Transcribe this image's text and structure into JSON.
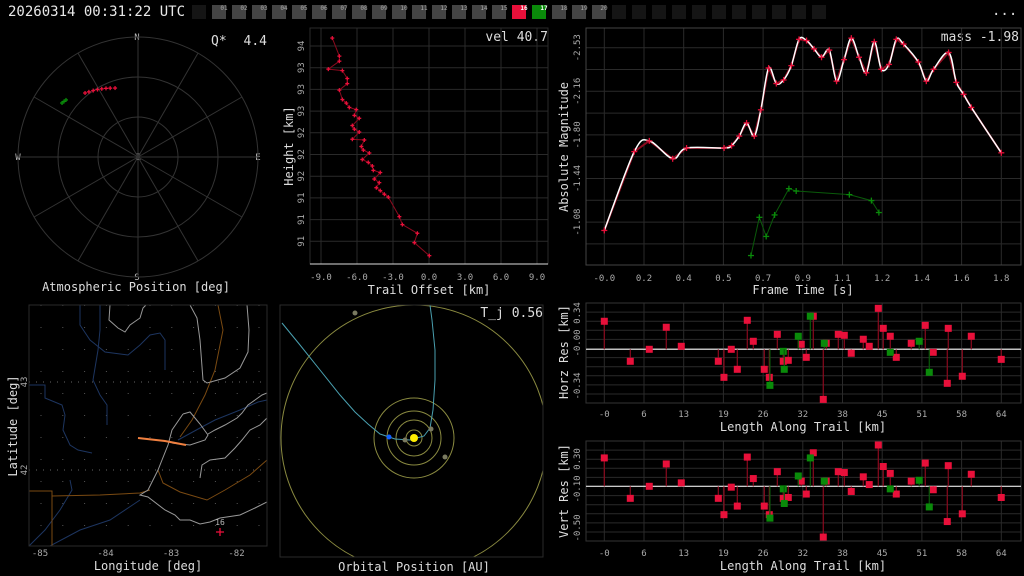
{
  "header": {
    "timestamp": "20260314 00:31:22 UTC",
    "more_label": "...",
    "stations": [
      {
        "label": "",
        "state": "empty"
      },
      {
        "label": "01",
        "state": "idle"
      },
      {
        "label": "02",
        "state": "idle"
      },
      {
        "label": "03",
        "state": "idle"
      },
      {
        "label": "04",
        "state": "idle"
      },
      {
        "label": "05",
        "state": "idle"
      },
      {
        "label": "06",
        "state": "idle"
      },
      {
        "label": "07",
        "state": "idle"
      },
      {
        "label": "08",
        "state": "idle"
      },
      {
        "label": "09",
        "state": "idle"
      },
      {
        "label": "10",
        "state": "idle"
      },
      {
        "label": "11",
        "state": "idle"
      },
      {
        "label": "12",
        "state": "idle"
      },
      {
        "label": "13",
        "state": "idle"
      },
      {
        "label": "14",
        "state": "idle"
      },
      {
        "label": "15",
        "state": "idle"
      },
      {
        "label": "16",
        "state": "red"
      },
      {
        "label": "17",
        "state": "green"
      },
      {
        "label": "18",
        "state": "idle"
      },
      {
        "label": "19",
        "state": "idle"
      },
      {
        "label": "20",
        "state": "idle"
      },
      {
        "label": "",
        "state": "empty"
      },
      {
        "label": "",
        "state": "empty"
      },
      {
        "label": "",
        "state": "empty"
      },
      {
        "label": "",
        "state": "empty"
      },
      {
        "label": "",
        "state": "empty"
      },
      {
        "label": "",
        "state": "empty"
      },
      {
        "label": "",
        "state": "empty"
      },
      {
        "label": "",
        "state": "empty"
      },
      {
        "label": "",
        "state": "empty"
      },
      {
        "label": "",
        "state": "empty"
      },
      {
        "label": "",
        "state": "empty"
      }
    ]
  },
  "colors": {
    "red": "#e8103a",
    "green": "#0a8a0a",
    "stem_red": "#8b0a1e",
    "stem_green": "#0a5a0a",
    "grid": "#2a2a2a",
    "idle": "#444444",
    "empty": "#151515"
  },
  "chart_data": [
    {
      "type": "scatter",
      "id": "atmospheric",
      "title": "Atmospheric Position [deg]",
      "annotation_label": "Q*",
      "annotation_value": "4.4",
      "directions": {
        "n": "N",
        "e": "E",
        "s": "S",
        "w": "W",
        "z": "Z"
      },
      "series": [
        {
          "name": "16",
          "color": "#e8103a",
          "points_az_el": [
            [
              320.4,
              27.7
            ],
            [
              323,
              28.8
            ],
            [
              326,
              29.9
            ],
            [
              329,
              31
            ],
            [
              332,
              32.1
            ],
            [
              335,
              33.2
            ],
            [
              338,
              34.3
            ],
            [
              341.6,
              35.5
            ]
          ]
        },
        {
          "name": "17",
          "color": "#0a8a0a",
          "points_az_el": [
            [
              305.4,
              20.1
            ],
            [
              306.9,
              20.6
            ],
            [
              308.4,
              21.1
            ]
          ]
        }
      ]
    },
    {
      "type": "line",
      "id": "height",
      "annotation_label": "vel",
      "annotation_value": "40.7",
      "xlabel": "Trail Offset [km]",
      "ylabel": "Height [km]",
      "xlim": [
        -9,
        9
      ],
      "xticks": [
        "-9.0",
        "-6.0",
        "-3.0",
        "0.0",
        "3.0",
        "6.0",
        "9.0"
      ],
      "yticks": [
        "94",
        "93",
        "93",
        "93",
        "92",
        "92",
        "92",
        "91",
        "91",
        "91"
      ],
      "points": [
        [
          -8.06,
          94.11
        ],
        [
          -7.47,
          93.86
        ],
        [
          -7.47,
          93.79
        ],
        [
          -8.39,
          93.68
        ],
        [
          -7.22,
          93.66
        ],
        [
          -6.81,
          93.55
        ],
        [
          -6.81,
          93.48
        ],
        [
          -7.47,
          93.39
        ],
        [
          -7.22,
          93.26
        ],
        [
          -6.89,
          93.21
        ],
        [
          -6.64,
          93.15
        ],
        [
          -6.06,
          93.12
        ],
        [
          -6.22,
          93.04
        ],
        [
          -5.81,
          93.0
        ],
        [
          -6.39,
          92.9
        ],
        [
          -6.22,
          92.85
        ],
        [
          -5.81,
          92.81
        ],
        [
          -6.39,
          92.71
        ],
        [
          -5.39,
          92.7
        ],
        [
          -5.64,
          92.61
        ],
        [
          -5.47,
          92.56
        ],
        [
          -4.97,
          92.52
        ],
        [
          -5.56,
          92.43
        ],
        [
          -5.06,
          92.39
        ],
        [
          -4.72,
          92.34
        ],
        [
          -4.64,
          92.28
        ],
        [
          -4.06,
          92.25
        ],
        [
          -4.56,
          92.16
        ],
        [
          -4.14,
          92.11
        ],
        [
          -4.39,
          92.04
        ],
        [
          -4.06,
          92.0
        ],
        [
          -3.72,
          91.95
        ],
        [
          -3.39,
          91.91
        ],
        [
          -2.47,
          91.64
        ],
        [
          -2.22,
          91.53
        ],
        [
          -0.97,
          91.41
        ],
        [
          -1.22,
          91.28
        ],
        [
          0.03,
          91.1
        ]
      ]
    },
    {
      "type": "line",
      "id": "magnitude",
      "annotation_label": "mass",
      "annotation_value": "-1.98",
      "xlabel": "Frame Time [s]",
      "ylabel": "Absolute Magnitude",
      "xlim": [
        0,
        1.8
      ],
      "xticks": [
        "-0.0",
        "0.2",
        "0.4",
        "0.5",
        "0.7",
        "0.9",
        "1.1",
        "1.2",
        "1.4",
        "1.6",
        "1.8"
      ],
      "yticks": [
        "-2.53",
        "-2.16",
        "-1.80",
        "-1.44",
        "-1.08"
      ],
      "series": [
        {
          "name": "16",
          "color": "#e8103a",
          "points": [
            [
              0,
              -1.0
            ],
            [
              0.136,
              -1.66
            ],
            [
              0.204,
              -1.75
            ],
            [
              0.31,
              -1.6
            ],
            [
              0.373,
              -1.69
            ],
            [
              0.543,
              -1.69
            ],
            [
              0.577,
              -1.71
            ],
            [
              0.612,
              -1.79
            ],
            [
              0.645,
              -1.9
            ],
            [
              0.68,
              -1.79
            ],
            [
              0.71,
              -2.01
            ],
            [
              0.745,
              -2.36
            ],
            [
              0.78,
              -2.23
            ],
            [
              0.813,
              -2.26
            ],
            [
              0.848,
              -2.38
            ],
            [
              0.883,
              -2.6
            ],
            [
              0.917,
              -2.59
            ],
            [
              0.951,
              -2.52
            ],
            [
              0.985,
              -2.45
            ],
            [
              1.02,
              -2.51
            ],
            [
              1.053,
              -2.25
            ],
            [
              1.087,
              -2.43
            ],
            [
              1.12,
              -2.61
            ],
            [
              1.155,
              -2.45
            ],
            [
              1.188,
              -2.32
            ],
            [
              1.224,
              -2.58
            ],
            [
              1.256,
              -2.35
            ],
            [
              1.291,
              -2.39
            ],
            [
              1.324,
              -2.6
            ],
            [
              1.357,
              -2.56
            ],
            [
              1.424,
              -2.41
            ],
            [
              1.46,
              -2.25
            ],
            [
              1.493,
              -2.35
            ],
            [
              1.561,
              -2.49
            ],
            [
              1.596,
              -2.24
            ],
            [
              1.629,
              -2.14
            ],
            [
              1.664,
              -2.03
            ],
            [
              1.8,
              -1.65
            ]
          ]
        },
        {
          "name": "17",
          "color": "#0a8a0a",
          "points": [
            [
              0.665,
              -0.79
            ],
            [
              0.703,
              -1.11
            ],
            [
              0.734,
              -0.95
            ],
            [
              0.772,
              -1.13
            ],
            [
              0.837,
              -1.35
            ],
            [
              0.87,
              -1.33
            ],
            [
              1.111,
              -1.3
            ],
            [
              1.211,
              -1.25
            ],
            [
              1.245,
              -1.15
            ]
          ]
        }
      ]
    },
    {
      "type": "scatter",
      "id": "horz_res",
      "xlabel": "Length Along Trail [km]",
      "ylabel": "Horz Res [km]",
      "xticks": [
        "-0",
        "6",
        "13",
        "19",
        "26",
        "32",
        "38",
        "45",
        "51",
        "58",
        "64"
      ],
      "yticks": [
        "0.34",
        "-0.00",
        "-0.34"
      ],
      "series": [
        {
          "name": "16",
          "points": [
            [
              0,
              0.262
            ],
            [
              4.19,
              -0.112
            ],
            [
              7.25,
              0
            ],
            [
              9.99,
              0.206
            ],
            [
              12.41,
              0.028
            ],
            [
              18.38,
              -0.112
            ],
            [
              19.29,
              -0.262
            ],
            [
              20.47,
              0
            ],
            [
              21.44,
              -0.187
            ],
            [
              23.05,
              0.271
            ],
            [
              24.02,
              0.075
            ],
            [
              25.79,
              -0.187
            ],
            [
              26.6,
              -0.262
            ],
            [
              27.89,
              0.14
            ],
            [
              28.85,
              -0.112
            ],
            [
              29.66,
              -0.103
            ],
            [
              31.75,
              0.047
            ],
            [
              32.56,
              -0.075
            ],
            [
              33.69,
              0.309
            ],
            [
              35.3,
              -0.468
            ],
            [
              35.78,
              0.056
            ],
            [
              37.72,
              0.14
            ],
            [
              38.69,
              0.131
            ],
            [
              39.81,
              -0.037
            ],
            [
              41.75,
              0.094
            ],
            [
              42.71,
              0.028
            ],
            [
              44.17,
              0.383
            ],
            [
              44.97,
              0.196
            ],
            [
              46.1,
              0.122
            ],
            [
              47.07,
              -0.075
            ],
            [
              49.48,
              0.056
            ],
            [
              51.74,
              0.224
            ],
            [
              53.03,
              -0.028
            ],
            [
              55.29,
              -0.318
            ],
            [
              55.45,
              0.196
            ],
            [
              57.71,
              -0.252
            ],
            [
              59.16,
              0.122
            ],
            [
              63.99,
              -0.094
            ]
          ]
        },
        {
          "name": "17",
          "points": [
            [
              26.7,
              -0.337
            ],
            [
              28.85,
              -0.019
            ],
            [
              29.01,
              -0.187
            ],
            [
              31.27,
              0.122
            ],
            [
              33.21,
              0.309
            ],
            [
              35.46,
              0.056
            ],
            [
              46.1,
              -0.028
            ],
            [
              50.77,
              0.075
            ],
            [
              52.39,
              -0.215
            ]
          ]
        }
      ]
    },
    {
      "type": "scatter",
      "id": "vert_res",
      "xlabel": "Length Along Trail [km]",
      "ylabel": "Vert Res [km]",
      "xticks": [
        "-0",
        "6",
        "13",
        "19",
        "26",
        "32",
        "38",
        "45",
        "51",
        "58",
        "64"
      ],
      "yticks": [
        "0.30",
        "-0.10",
        "-0.50"
      ],
      "series": [
        {
          "name": "16",
          "points": [
            [
              0,
              0.33
            ],
            [
              4.19,
              -0.14
            ],
            [
              7.25,
              0
            ],
            [
              9.99,
              0.26
            ],
            [
              12.41,
              0.04
            ],
            [
              18.38,
              -0.14
            ],
            [
              19.29,
              -0.33
            ],
            [
              20.47,
              -0.01
            ],
            [
              21.44,
              -0.23
            ],
            [
              23.05,
              0.34
            ],
            [
              24.02,
              0.09
            ],
            [
              25.79,
              -0.23
            ],
            [
              26.6,
              -0.33
            ],
            [
              27.89,
              0.17
            ],
            [
              28.85,
              -0.14
            ],
            [
              29.66,
              -0.13
            ],
            [
              31.75,
              0.06
            ],
            [
              32.56,
              -0.09
            ],
            [
              33.69,
              0.39
            ],
            [
              35.3,
              -0.59
            ],
            [
              35.78,
              0.06
            ],
            [
              37.72,
              0.17
            ],
            [
              38.69,
              0.16
            ],
            [
              39.81,
              -0.06
            ],
            [
              41.75,
              0.11
            ],
            [
              42.71,
              0.02
            ],
            [
              44.17,
              0.48
            ],
            [
              44.97,
              0.23
            ],
            [
              46.1,
              0.15
            ],
            [
              47.07,
              -0.09
            ],
            [
              49.48,
              0.06
            ],
            [
              51.74,
              0.27
            ],
            [
              53.03,
              -0.04
            ],
            [
              55.29,
              -0.41
            ],
            [
              55.45,
              0.24
            ],
            [
              57.71,
              -0.32
            ],
            [
              59.16,
              0.14
            ],
            [
              63.99,
              -0.13
            ]
          ]
        },
        {
          "name": "17",
          "points": [
            [
              26.7,
              -0.37
            ],
            [
              28.85,
              -0.03
            ],
            [
              29.01,
              -0.2
            ],
            [
              31.27,
              0.12
            ],
            [
              33.21,
              0.33
            ],
            [
              35.46,
              0.06
            ],
            [
              46.1,
              -0.03
            ],
            [
              50.77,
              0.07
            ],
            [
              52.39,
              -0.24
            ]
          ]
        }
      ]
    },
    {
      "type": "map",
      "id": "ground_map",
      "xlabel": "Longitude [deg]",
      "ylabel": "Latitude [deg]",
      "xticks": [
        "-85",
        "-84",
        "-83",
        "-82"
      ],
      "yticks": [
        "43",
        "42"
      ],
      "station_label": "16"
    },
    {
      "type": "diagram",
      "id": "orbit",
      "title": "Orbital Position [AU]",
      "annotation_label": "T_j",
      "annotation_value": "0.56"
    }
  ]
}
